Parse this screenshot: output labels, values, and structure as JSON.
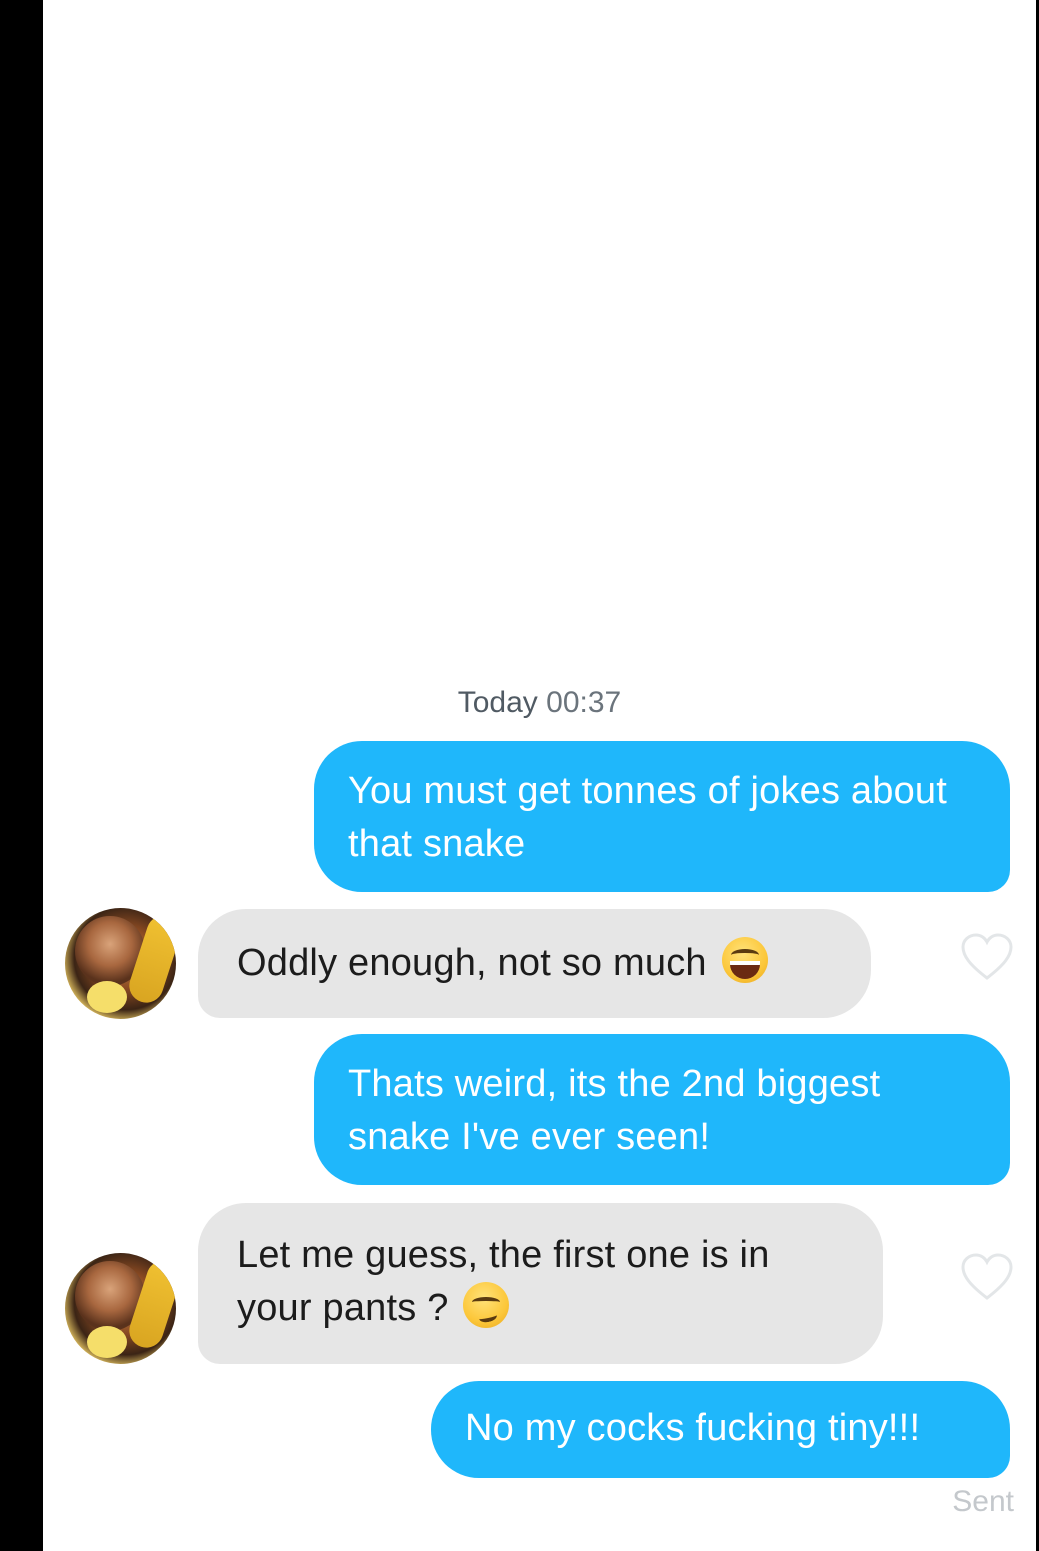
{
  "chat": {
    "timestamp_day": "Today",
    "timestamp_time": "00:37",
    "messages": [
      {
        "direction": "out",
        "text": "You must get tonnes of jokes about that snake"
      },
      {
        "direction": "in",
        "text": "Oddly enough, not so much",
        "emoji": "laughing-tears-emoji"
      },
      {
        "direction": "out",
        "text": "Thats weird, its the 2nd biggest snake I've ever seen!"
      },
      {
        "direction": "in",
        "text": "Let me guess, the first one is in your pants ?",
        "emoji": "smirk-emoji"
      },
      {
        "direction": "out",
        "text": "No my cocks fucking tiny!!!"
      }
    ],
    "delivery_status": "Sent"
  },
  "colors": {
    "outgoing_bubble": "#1fb7fb",
    "incoming_bubble": "#e6e6e6",
    "background": "#ffffff"
  }
}
